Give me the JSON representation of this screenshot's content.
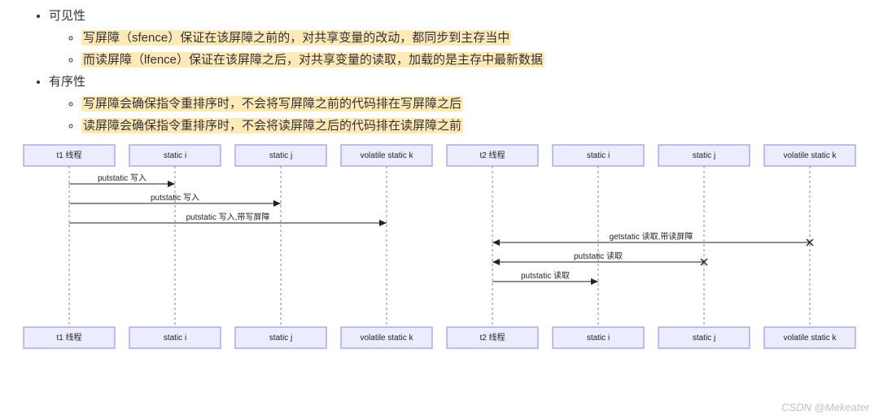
{
  "bullets": {
    "b1": {
      "title": "可见性",
      "items": [
        "写屏障（sfence）保证在该屏障之前的，对共享变量的改动，都同步到主存当中",
        "而读屏障（lfence）保证在该屏障之后，对共享变量的读取，加载的是主存中最新数据"
      ]
    },
    "b2": {
      "title": "有序性",
      "items": [
        "写屏障会确保指令重排序时，不会将写屏障之前的代码排在写屏障之后",
        "读屏障会确保指令重排序时，不会将读屏障之后的代码排在读屏障之前"
      ]
    }
  },
  "lifelines": [
    "t1 线程",
    "static i",
    "static j",
    "volatile static k",
    "t2 线程",
    "static i",
    "static j",
    "volatile static k"
  ],
  "messages": [
    {
      "from": 0,
      "to": 1,
      "text": "putstatic 写入",
      "type": "solid"
    },
    {
      "from": 0,
      "to": 2,
      "text": "putstatic 写入",
      "type": "solid"
    },
    {
      "from": 0,
      "to": 3,
      "text": "putstatic 写入,带写屏障",
      "type": "solid"
    },
    {
      "from": 4,
      "to": 7,
      "text": "getstatic 读取,带读屏障",
      "type": "found"
    },
    {
      "from": 4,
      "to": 6,
      "text": "putstatic 读取",
      "type": "found"
    },
    {
      "from": 4,
      "to": 5,
      "text": "putstatic 读取",
      "type": "solid"
    }
  ],
  "watermark": "CSDN @Mekeater"
}
